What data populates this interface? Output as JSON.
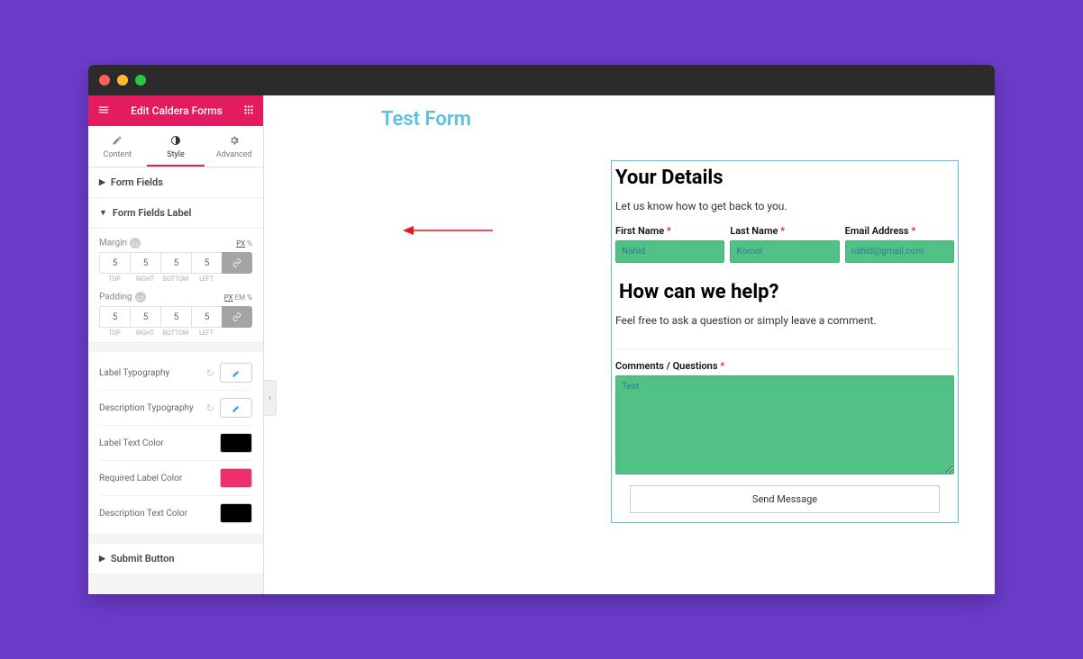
{
  "sidebar": {
    "header_title": "Edit Caldera Forms",
    "tabs": {
      "content": "Content",
      "style": "Style",
      "advanced": "Advanced"
    },
    "sections": {
      "form_fields": "Form Fields",
      "form_fields_label": "Form Fields Label",
      "submit_button": "Submit Button"
    },
    "margin": {
      "label": "Margin",
      "units": [
        "PX",
        "%"
      ],
      "active_unit": "PX",
      "top": "5",
      "right": "5",
      "bottom": "5",
      "left": "5",
      "lbls": [
        "TOP",
        "RIGHT",
        "BOTTOM",
        "LEFT"
      ]
    },
    "padding": {
      "label": "Padding",
      "units": [
        "PX",
        "EM",
        "%"
      ],
      "active_unit": "PX",
      "top": "5",
      "right": "5",
      "bottom": "5",
      "left": "5",
      "lbls": [
        "TOP",
        "RIGHT",
        "BOTTOM",
        "LEFT"
      ]
    },
    "controls": {
      "label_typo": "Label Typography",
      "desc_typo": "Description Typography",
      "label_color": "Label Text Color",
      "required_color": "Required Label Color",
      "desc_color": "Description Text Color"
    },
    "colors": {
      "label_color": "#000000",
      "required_color": "#ef2e6b",
      "desc_color": "#000000"
    }
  },
  "page": {
    "title": "Test Form",
    "form": {
      "heading1": "Your Details",
      "sub1": "Let us know how to get back to you.",
      "first_name_label": "First Name",
      "last_name_label": "Last Name",
      "email_label": "Email Address",
      "first_name_val": "Nahid",
      "last_name_val": "Komol",
      "email_val": "nahid@gmail.com",
      "heading2": "How can we help?",
      "sub2": "Feel free to ask a question or simply leave a comment.",
      "comments_label": "Comments / Questions",
      "comments_val": "Test",
      "submit_label": "Send Message",
      "asterisk": "*"
    }
  }
}
